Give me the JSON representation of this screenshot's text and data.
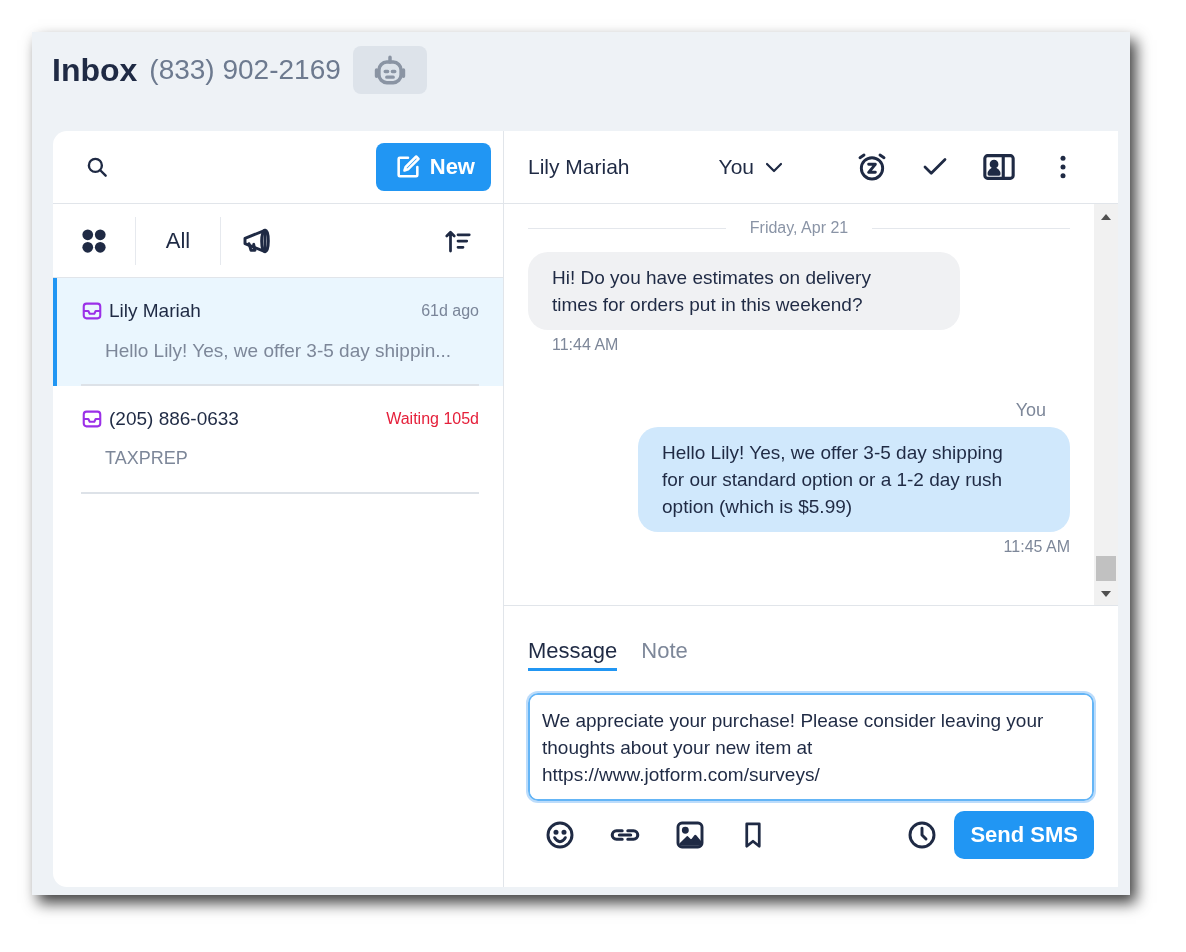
{
  "header": {
    "title": "Inbox",
    "phone": "(833) 902-2169"
  },
  "sidebar": {
    "new_button": "New",
    "filter_label": "All",
    "conversations": [
      {
        "name": "Lily Mariah",
        "time": "61d ago",
        "waiting": false,
        "preview": "Hello Lily! Yes, we offer 3-5 day shippin...",
        "selected": true
      },
      {
        "name": "(205) 886-0633",
        "time": "Waiting 105d",
        "waiting": true,
        "preview": "TAXPREP",
        "selected": false
      }
    ]
  },
  "conversation": {
    "contact": "Lily Mariah",
    "assignee": "You",
    "date": "Friday, Apr 21",
    "messages": [
      {
        "kind": "incoming",
        "text": "Hi! Do you have estimates on delivery times for orders put in this weekend?",
        "time": "11:44 AM"
      },
      {
        "kind": "outgoing",
        "sender": "You",
        "text": "Hello Lily! Yes, we offer 3-5 day shipping for our standard option or a 1-2 day rush option (which is $5.99)",
        "time": "11:45 AM"
      }
    ]
  },
  "composer": {
    "tabs": [
      {
        "label": "Message",
        "selected": true
      },
      {
        "label": "Note",
        "selected": false
      }
    ],
    "value": "We appreciate your purchase! Please consider leaving your thoughts about your new item at https://www.jotform.com/surveys/",
    "send_button": "Send SMS"
  }
}
